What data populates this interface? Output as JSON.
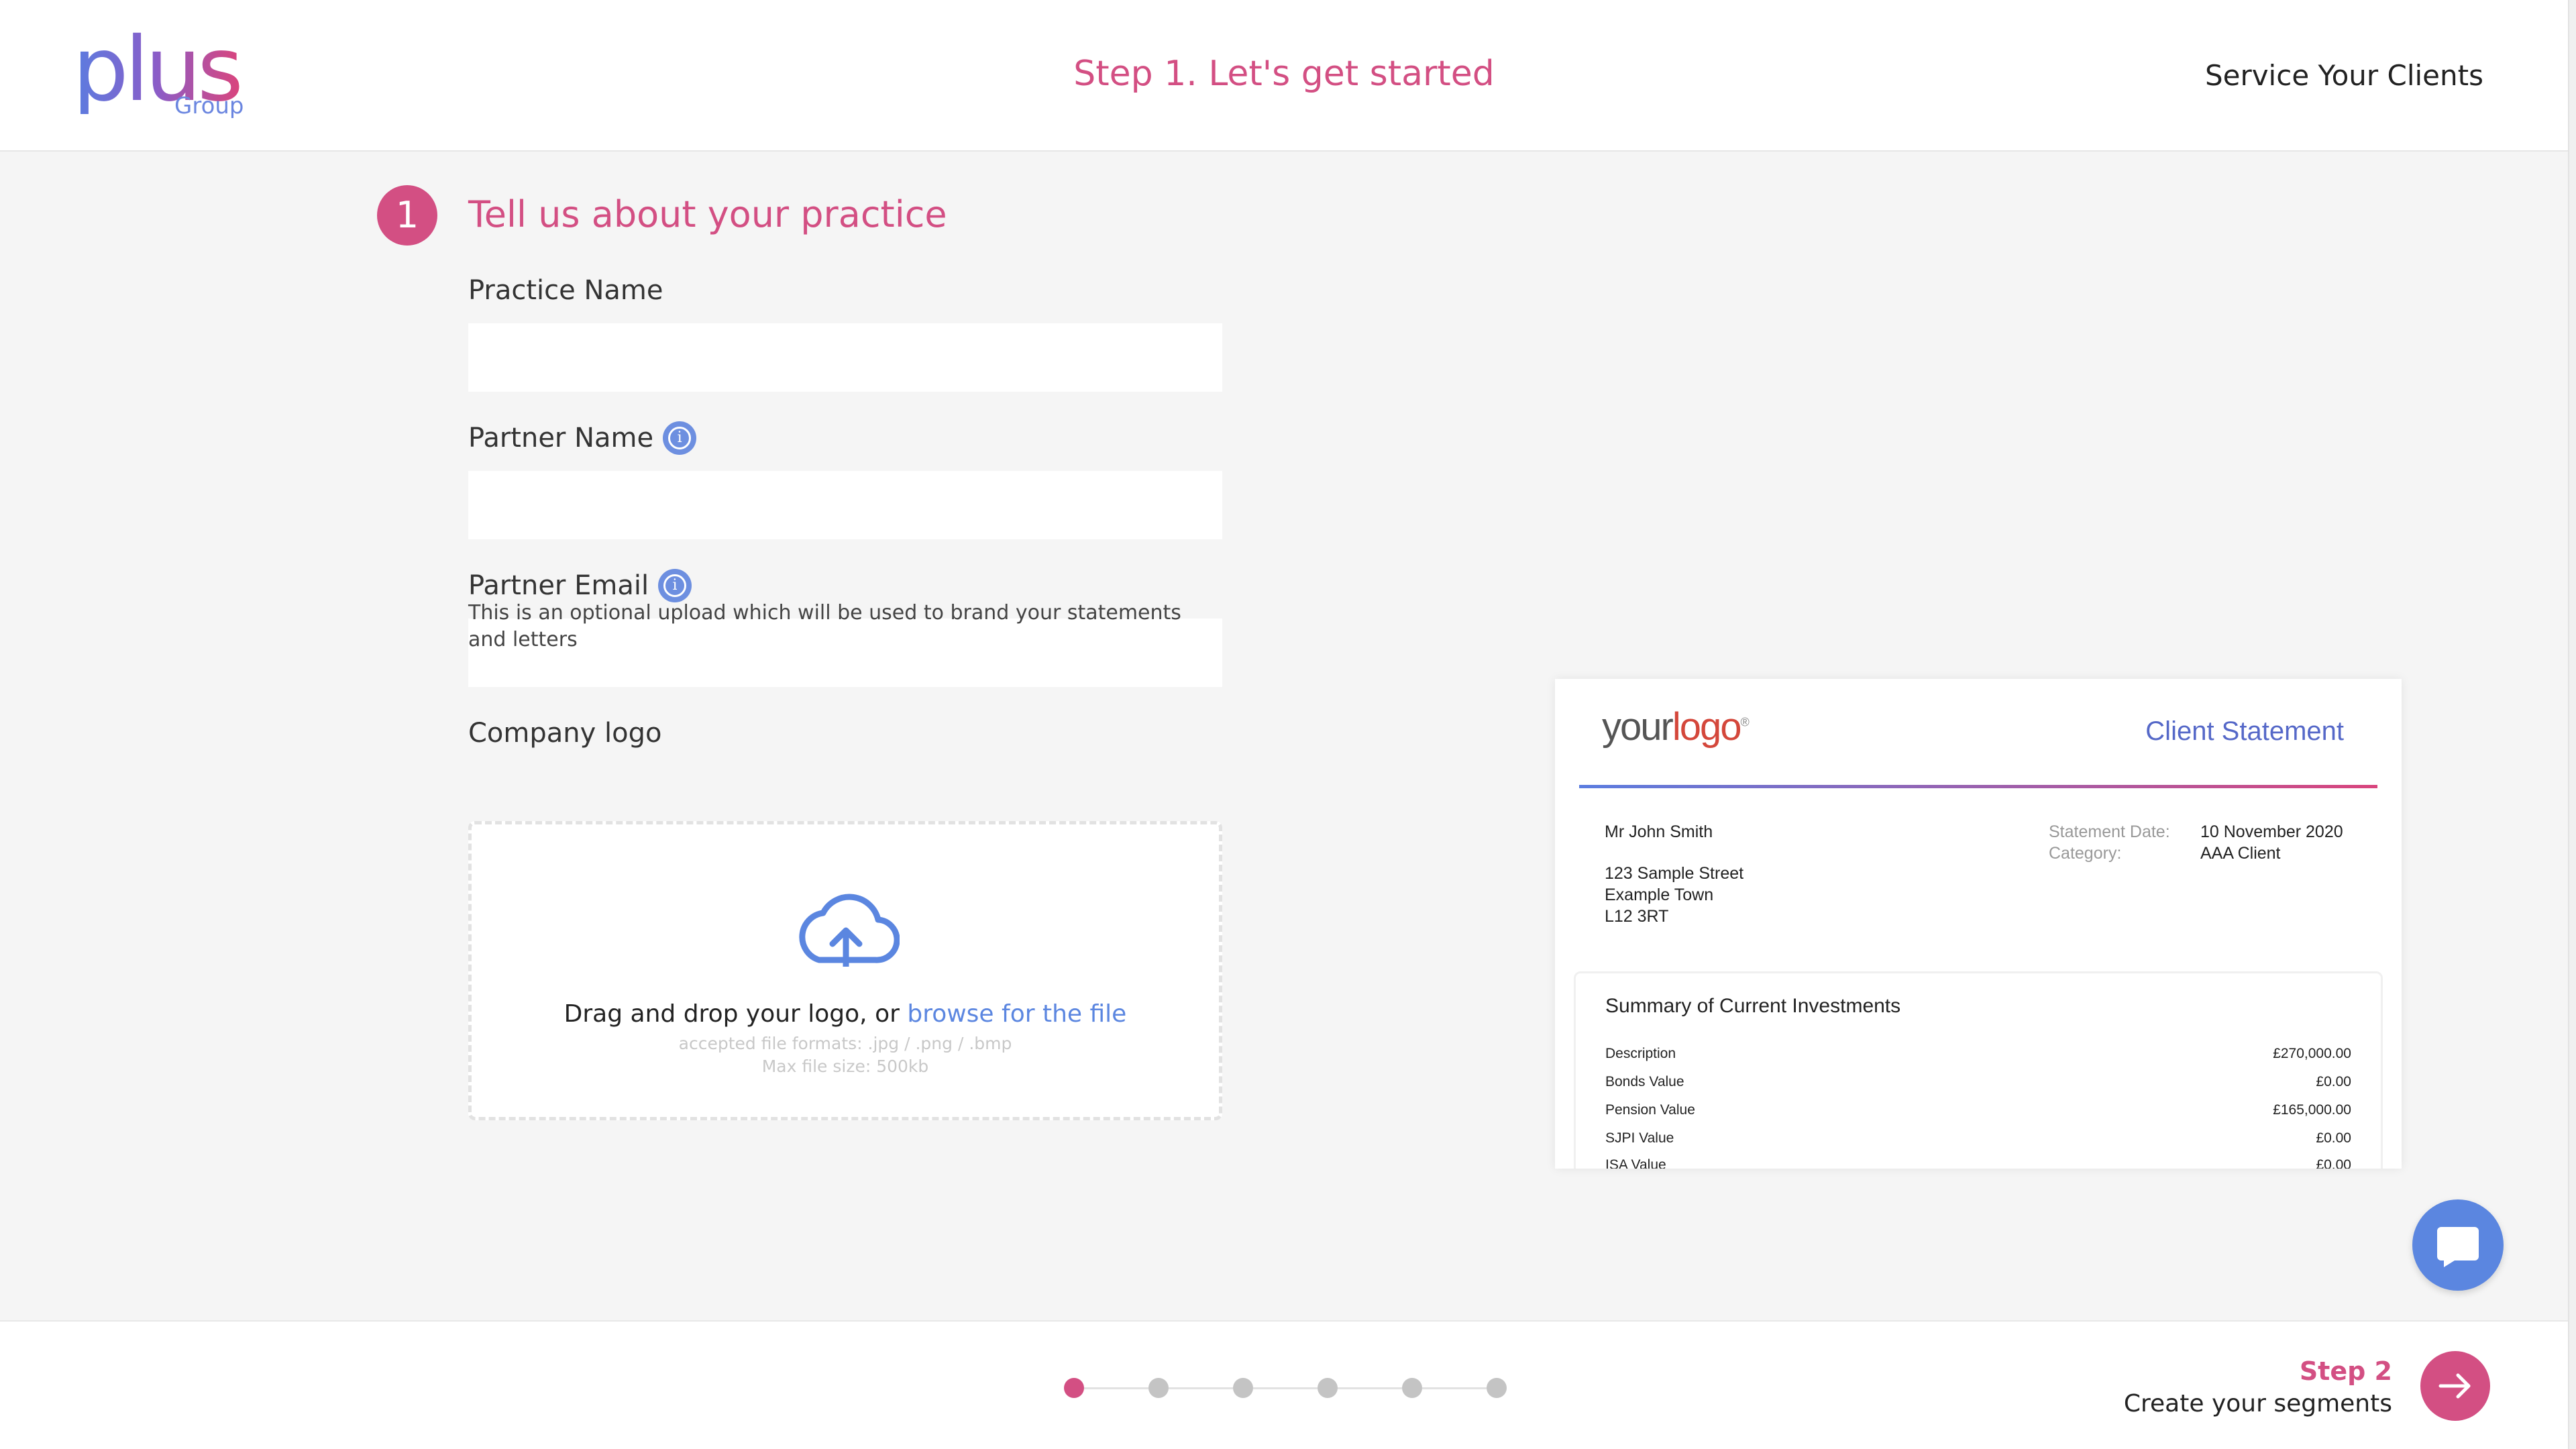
{
  "header": {
    "logo_text": "plus",
    "logo_sub": "Group",
    "title": "Step 1. Let's get started",
    "right_text": "Service Your Clients"
  },
  "section": {
    "number": "1",
    "title": "Tell us about your practice"
  },
  "fields": {
    "practice_name": {
      "label": "Practice Name",
      "value": ""
    },
    "partner_name": {
      "label": "Partner Name",
      "value": ""
    },
    "partner_email": {
      "label": "Partner Email",
      "value": ""
    }
  },
  "upload": {
    "label": "Company logo",
    "helper": "This is an optional upload which will be used to brand your statements and letters",
    "drop_text": "Drag and drop your logo, or ",
    "browse_link": "browse for the file",
    "formats": "accepted file formats: .jpg / .png / .bmp",
    "max_size": "Max file size: 500kb"
  },
  "statement_preview": {
    "logo_your": "your",
    "logo_logo": "logo",
    "logo_mark": "®",
    "title": "Client Statement",
    "client_name": "Mr John Smith",
    "address_line1": "123 Sample Street",
    "address_line2": "Example Town",
    "address_line3": "L12 3RT",
    "statement_date_label": "Statement Date:",
    "statement_date_value": "10 November 2020",
    "category_label": "Category:",
    "category_value": "AAA Client",
    "summary_title": "Summary of Current Investments",
    "rows": [
      {
        "label": "Description",
        "value": "£270,000.00"
      },
      {
        "label": "Bonds Value",
        "value": "£0.00"
      },
      {
        "label": "Pension Value",
        "value": "£165,000.00"
      },
      {
        "label": "SJPI Value",
        "value": "£0.00"
      },
      {
        "label": "ISA Value",
        "value": "£0.00"
      }
    ]
  },
  "footer": {
    "progress_total": 6,
    "progress_current": 1,
    "next_step_label": "Step 2",
    "next_step_desc": "Create your segments"
  },
  "colors": {
    "brand_pink": "#d34f83",
    "brand_blue": "#5b86e0",
    "background": "#f5f5f5"
  },
  "icons": {
    "info": "info-icon",
    "upload": "cloud-upload-icon",
    "chat": "chat-icon",
    "next": "arrow-right-icon"
  }
}
